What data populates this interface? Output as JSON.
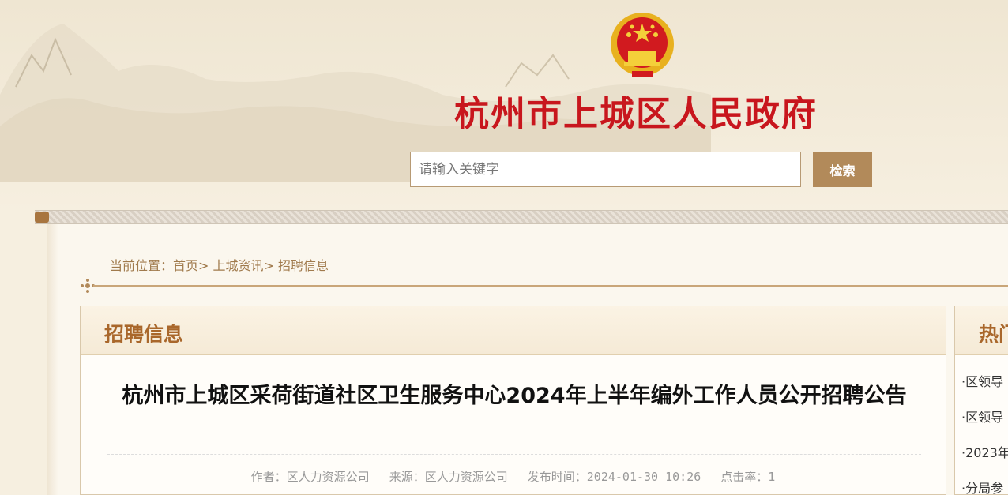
{
  "header": {
    "site_title": "杭州市上城区人民政府",
    "search": {
      "placeholder": "请输入关键字",
      "button_label": "检索"
    }
  },
  "breadcrumb": {
    "prefix": "当前位置：",
    "items": [
      "首页",
      "上城资讯",
      "招聘信息"
    ],
    "separator": ">"
  },
  "main": {
    "section_title": "招聘信息",
    "article": {
      "title": "杭州市上城区采荷街道社区卫生服务中心2024年上半年编外工作人员公开招聘公告",
      "author": "作者：区人力资源公司",
      "source": "来源：区人力资源公司",
      "publish_time": "发布时间：2024-01-30 10:26",
      "clicks": "点击率：1"
    }
  },
  "sidebar": {
    "title": "热门",
    "items": [
      "·区领导",
      "·区领导",
      "·2023年",
      "·分局参"
    ]
  },
  "colors": {
    "title_red": "#c8161d",
    "accent_brown": "#b28a5a",
    "section_title": "#a9672b"
  }
}
